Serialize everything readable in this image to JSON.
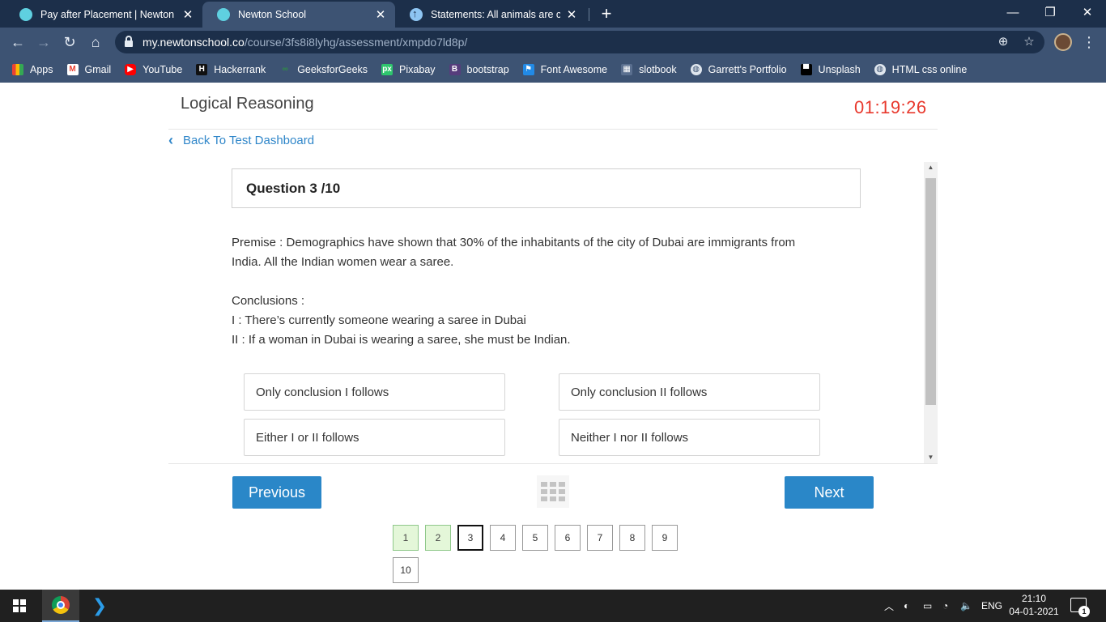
{
  "browser": {
    "tabs": [
      {
        "title": "Pay after Placement | Newton Sc",
        "close": "✕"
      },
      {
        "title": "Newton School",
        "close": "✕"
      },
      {
        "title": "Statements: All animals are cats. S",
        "close": "✕"
      }
    ],
    "new_tab": "+",
    "window_controls": {
      "minimize": "—",
      "maximize": "❐",
      "close": "✕"
    },
    "url_host": "my.newtonschool.co",
    "url_path": "/course/3fs8i8lyhg/assessment/xmpdo7ld8p/",
    "bookmarks": [
      {
        "label": "Apps",
        "icon": "apps-grid-icon"
      },
      {
        "label": "Gmail",
        "icon": "gmail-icon"
      },
      {
        "label": "YouTube",
        "icon": "youtube-icon"
      },
      {
        "label": "Hackerrank",
        "icon": "hackerrank-icon"
      },
      {
        "label": "GeeksforGeeks",
        "icon": "geeksforgeeks-icon"
      },
      {
        "label": "Pixabay",
        "icon": "pixabay-icon"
      },
      {
        "label": "bootstrap",
        "icon": "bootstrap-icon"
      },
      {
        "label": "Font Awesome",
        "icon": "font-awesome-icon"
      },
      {
        "label": "slotbook",
        "icon": "slotbook-icon"
      },
      {
        "label": "Garrett's Portfolio",
        "icon": "globe-icon"
      },
      {
        "label": "Unsplash",
        "icon": "unsplash-icon"
      },
      {
        "label": "HTML css online",
        "icon": "globe-icon"
      }
    ]
  },
  "page": {
    "title": "Logical Reasoning",
    "timer": "01:19:26",
    "back_link": "Back To Test Dashboard"
  },
  "question": {
    "header": "Question 3 /10",
    "premise_line1": "Premise : Demographics have shown that 30% of the inhabitants of the city of Dubai are immigrants from",
    "premise_line2": "India. All the Indian women wear a saree.",
    "conclusions_label": "Conclusions :",
    "conclusion_1": "I : There’s currently someone wearing a saree in Dubai",
    "conclusion_2": "II : If a woman in Dubai is wearing a saree, she must be Indian.",
    "options": [
      "Only conclusion I follows",
      "Only conclusion II follows",
      "Either I or II follows",
      "Neither I nor II follows"
    ]
  },
  "navigation": {
    "previous": "Previous",
    "next": "Next",
    "pages": [
      "1",
      "2",
      "3",
      "4",
      "5",
      "6",
      "7",
      "8",
      "9",
      "10"
    ],
    "answered": [
      "1",
      "2"
    ],
    "current": "3"
  },
  "taskbar": {
    "language": "ENG",
    "time": "21:10",
    "date": "04-01-2021",
    "notification_count": "1"
  }
}
